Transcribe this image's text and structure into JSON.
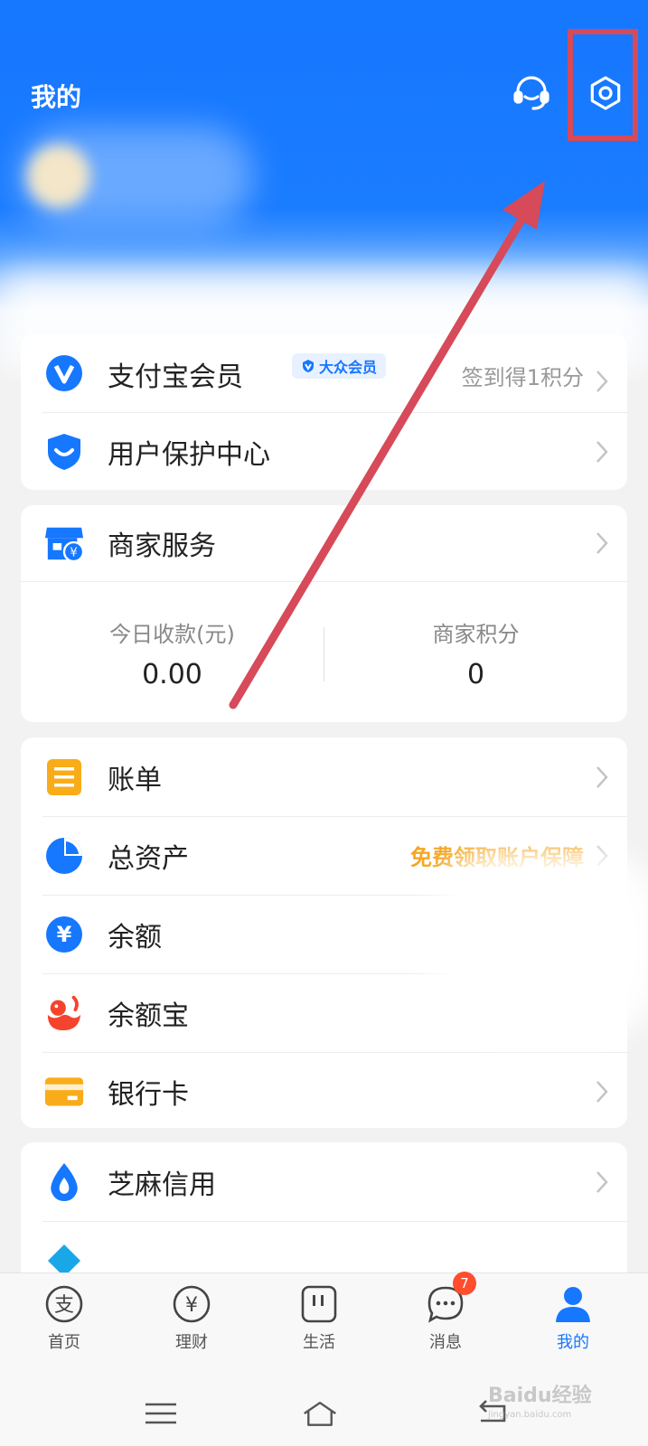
{
  "header": {
    "title": "我的"
  },
  "card1": {
    "member": {
      "label": "支付宝会员",
      "badge": "大众会员",
      "right": "签到得1积分"
    },
    "protect": {
      "label": "用户保护中心"
    }
  },
  "merchant": {
    "label": "商家服务",
    "stats": [
      {
        "label": "今日收款(元)",
        "value": "0.00"
      },
      {
        "label": "商家积分",
        "value": "0"
      }
    ]
  },
  "assets": {
    "items": [
      {
        "label": "账单",
        "right": ""
      },
      {
        "label": "总资产",
        "right": "免费领取账户保障"
      },
      {
        "label": "余额",
        "right": ""
      },
      {
        "label": "余额宝",
        "right": ""
      },
      {
        "label": "银行卡",
        "right": ""
      }
    ]
  },
  "credit": {
    "label": "芝麻信用"
  },
  "tabbar": {
    "tabs": [
      {
        "label": "首页"
      },
      {
        "label": "理财"
      },
      {
        "label": "生活"
      },
      {
        "label": "消息",
        "badge": "7"
      },
      {
        "label": "我的"
      }
    ]
  },
  "watermark": {
    "brand": "Baidu经验",
    "url": "jingyan.baidu.com"
  },
  "colors": {
    "brand_blue": "#1677ff",
    "annotation_red": "#d64a5a",
    "promo_orange": "#f5a623"
  },
  "icons": [
    "headset-icon",
    "gear-icon",
    "member-v-icon",
    "shield-icon",
    "store-icon",
    "bill-icon",
    "pie-chart-icon",
    "yuan-circle-icon",
    "whale-icon",
    "bank-card-icon",
    "sesame-drop-icon"
  ]
}
